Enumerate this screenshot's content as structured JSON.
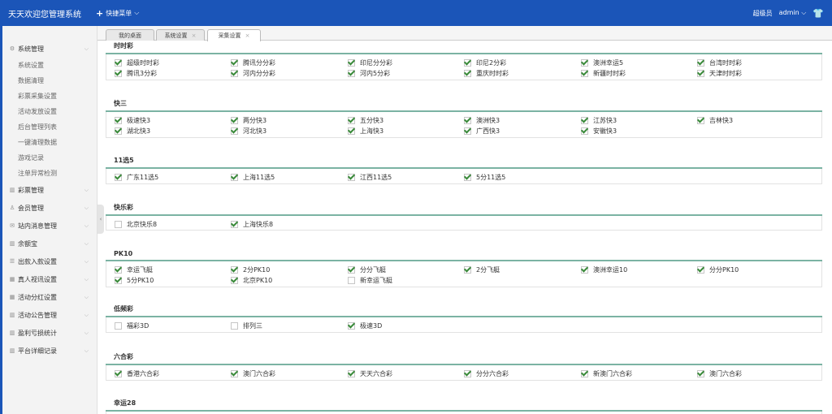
{
  "topbar": {
    "title": "天天欢迎您管理系统",
    "quick_menu": "快捷菜单",
    "role": "超级员",
    "user": "admin"
  },
  "sidebar": {
    "groups": [
      {
        "label": "系统管理",
        "icon": "gear-icon",
        "glyph": "⚙"
      },
      {
        "label": "彩票管理",
        "icon": "chart-icon",
        "glyph": "▥"
      },
      {
        "label": "会员管理",
        "icon": "user-icon",
        "glyph": "♙"
      },
      {
        "label": "站内消息管理",
        "icon": "mail-icon",
        "glyph": "✉"
      },
      {
        "label": "余额宝",
        "icon": "chart-icon",
        "glyph": "▥"
      },
      {
        "label": "出款入款设置",
        "icon": "list-icon",
        "glyph": "☰"
      },
      {
        "label": "真人视讯设置",
        "icon": "grid-icon",
        "glyph": "▦"
      },
      {
        "label": "活动分红设置",
        "icon": "grid-icon",
        "glyph": "▦"
      },
      {
        "label": "活动公告管理",
        "icon": "grid-icon",
        "glyph": "▥"
      },
      {
        "label": "盈利亏损统计",
        "icon": "chart-icon",
        "glyph": "▥"
      },
      {
        "label": "平台详细记录",
        "icon": "grid-icon",
        "glyph": "▥"
      }
    ],
    "subitems": [
      "系统设置",
      "数据清理",
      "彩票采集设置",
      "活动发放设置",
      "后台管理列表",
      "一键清理数据",
      "游戏记录",
      "注单异常检测"
    ]
  },
  "tabs": [
    "我的桌面",
    "系统设置",
    "采集设置"
  ],
  "sections": [
    {
      "title": "时时彩",
      "items": [
        {
          "label": "超级时时彩",
          "checked": true
        },
        {
          "label": "腾讯分分彩",
          "checked": true
        },
        {
          "label": "印尼分分彩",
          "checked": true
        },
        {
          "label": "印尼2分彩",
          "checked": true
        },
        {
          "label": "澳洲幸运5",
          "checked": true
        },
        {
          "label": "台湾时时彩",
          "checked": true
        },
        {
          "label": "腾讯3分彩",
          "checked": true
        },
        {
          "label": "河内分分彩",
          "checked": true
        },
        {
          "label": "河内5分彩",
          "checked": true
        },
        {
          "label": "重庆时时彩",
          "checked": true
        },
        {
          "label": "新疆时时彩",
          "checked": true
        },
        {
          "label": "天津时时彩",
          "checked": true
        }
      ]
    },
    {
      "title": "快三",
      "items": [
        {
          "label": "极速快3",
          "checked": true
        },
        {
          "label": "两分快3",
          "checked": true
        },
        {
          "label": "五分快3",
          "checked": true
        },
        {
          "label": "澳洲快3",
          "checked": true
        },
        {
          "label": "江苏快3",
          "checked": true
        },
        {
          "label": "吉林快3",
          "checked": true
        },
        {
          "label": "湖北快3",
          "checked": true
        },
        {
          "label": "河北快3",
          "checked": true
        },
        {
          "label": "上海快3",
          "checked": true
        },
        {
          "label": "广西快3",
          "checked": true
        },
        {
          "label": "安徽快3",
          "checked": true
        }
      ]
    },
    {
      "title": "11选5",
      "items": [
        {
          "label": "广东11选5",
          "checked": true
        },
        {
          "label": "上海11选5",
          "checked": true
        },
        {
          "label": "江西11选5",
          "checked": true
        },
        {
          "label": "5分11选5",
          "checked": true
        }
      ]
    },
    {
      "title": "快乐彩",
      "items": [
        {
          "label": "北京快乐8",
          "checked": false
        },
        {
          "label": "上海快乐8",
          "checked": true
        }
      ]
    },
    {
      "title": "PK10",
      "items": [
        {
          "label": "幸运飞艇",
          "checked": true
        },
        {
          "label": "2分PK10",
          "checked": true
        },
        {
          "label": "分分飞艇",
          "checked": true
        },
        {
          "label": "2分飞艇",
          "checked": true
        },
        {
          "label": "澳洲幸运10",
          "checked": true
        },
        {
          "label": "分分PK10",
          "checked": true
        },
        {
          "label": "5分PK10",
          "checked": true
        },
        {
          "label": "北京PK10",
          "checked": true
        },
        {
          "label": "新幸运飞艇",
          "checked": false
        }
      ]
    },
    {
      "title": "低频彩",
      "items": [
        {
          "label": "福彩3D",
          "checked": false
        },
        {
          "label": "排列三",
          "checked": false
        },
        {
          "label": "极速3D",
          "checked": true
        }
      ]
    },
    {
      "title": "六合彩",
      "items": [
        {
          "label": "香港六合彩",
          "checked": true
        },
        {
          "label": "澳门六合彩",
          "checked": true
        },
        {
          "label": "天天六合彩",
          "checked": true
        },
        {
          "label": "分分六合彩",
          "checked": true
        },
        {
          "label": "新澳门六合彩",
          "checked": true
        },
        {
          "label": "澳门六合彩",
          "checked": true
        }
      ]
    },
    {
      "title": "幸运28",
      "items": []
    }
  ]
}
